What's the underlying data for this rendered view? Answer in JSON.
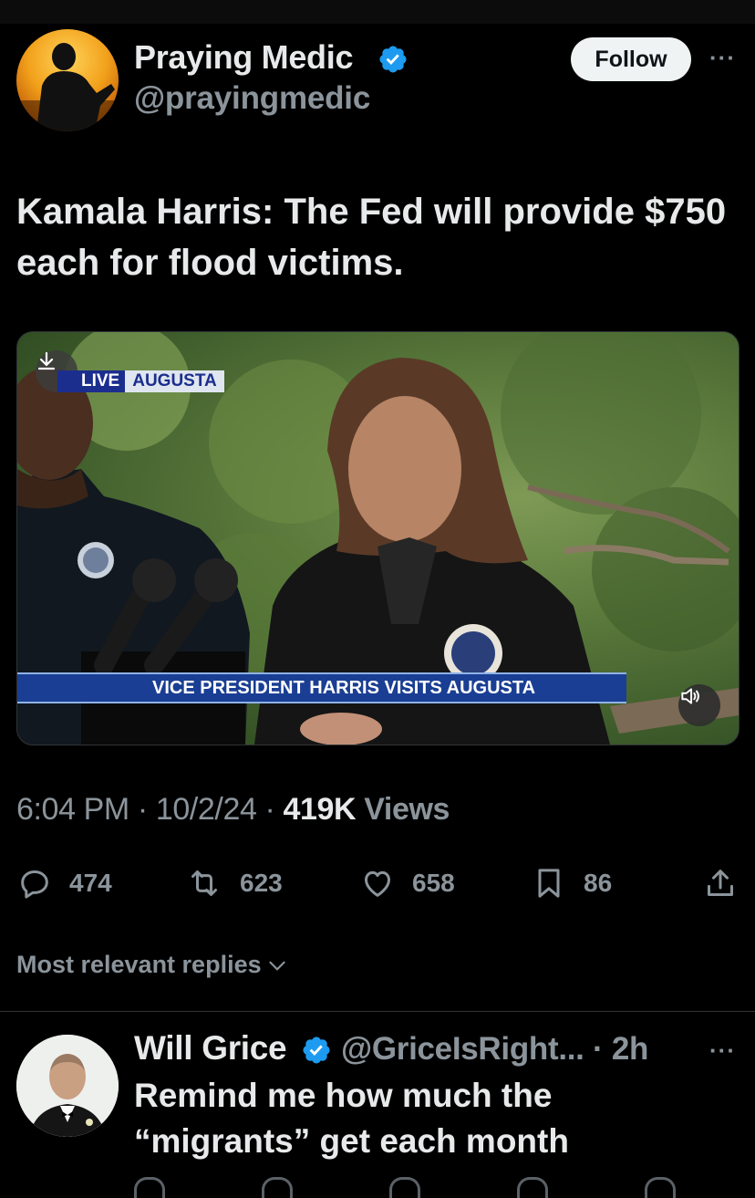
{
  "tweet": {
    "author": {
      "name": "Praying Medic",
      "handle": "@prayingmedic",
      "verified_icon": "verified-badge-icon"
    },
    "follow_label": "Follow",
    "more_icon": "more-horizontal-icon",
    "text": "Kamala Harris: The Fed will provide $750 each for flood victims.",
    "media": {
      "live_label": "LIVE",
      "location_label": "AUGUSTA",
      "chyron": "VICE PRESIDENT HARRIS VISITS AUGUSTA",
      "download_icon": "download-icon",
      "sound_icon": "speaker-icon"
    },
    "meta": {
      "time": "6:04 PM",
      "sep1": " · ",
      "date": "10/2/24",
      "sep2": " · ",
      "views_count": "419K",
      "views_label": " Views"
    },
    "actions": {
      "replies": "474",
      "reposts": "623",
      "likes": "658",
      "bookmarks": "86"
    }
  },
  "replies_sort_label": "Most relevant replies",
  "reply": {
    "name": "Will Grice",
    "handle": "@GriceIsRight...",
    "time": "· 2h",
    "text": "Remind me how much the “migrants” get each month"
  },
  "colors": {
    "background": "#000000",
    "text_primary": "#e7e9ea",
    "text_secondary": "#8b949b",
    "verified": "#1d9bf0",
    "follow_button": "#eff3f4"
  }
}
